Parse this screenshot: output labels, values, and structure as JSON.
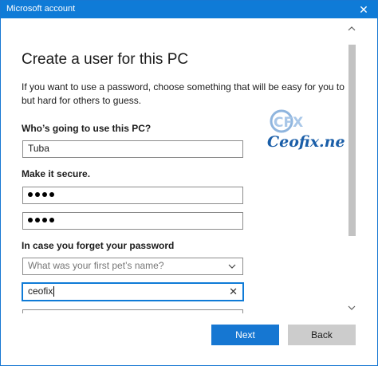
{
  "window": {
    "title": "Microsoft account",
    "close_glyph": "✕"
  },
  "page": {
    "heading": "Create a user for this PC",
    "intro_line1": "If you want to use a password, choose something that will be easy for you to remember",
    "intro_line2": "but hard for others to guess."
  },
  "user_section": {
    "label": "Who’s going to use this PC?",
    "username_value": "Tuba"
  },
  "password_section": {
    "label": "Make it secure.",
    "password_dots": 4,
    "confirm_dots": 4
  },
  "recovery_section": {
    "label": "In case you forget your password",
    "question_placeholder": "What was your first pet’s name?",
    "answer_value": "ceofix",
    "clear_glyph": "✕"
  },
  "watermark": {
    "text": "Ceofix.net",
    "logo_letters": "CFX"
  },
  "buttons": {
    "next": "Next",
    "back": "Back"
  },
  "colors": {
    "accent": "#0f7bd7",
    "button_primary": "#1677d2",
    "button_secondary": "#cccccc",
    "watermark": "#1a5ea8"
  }
}
